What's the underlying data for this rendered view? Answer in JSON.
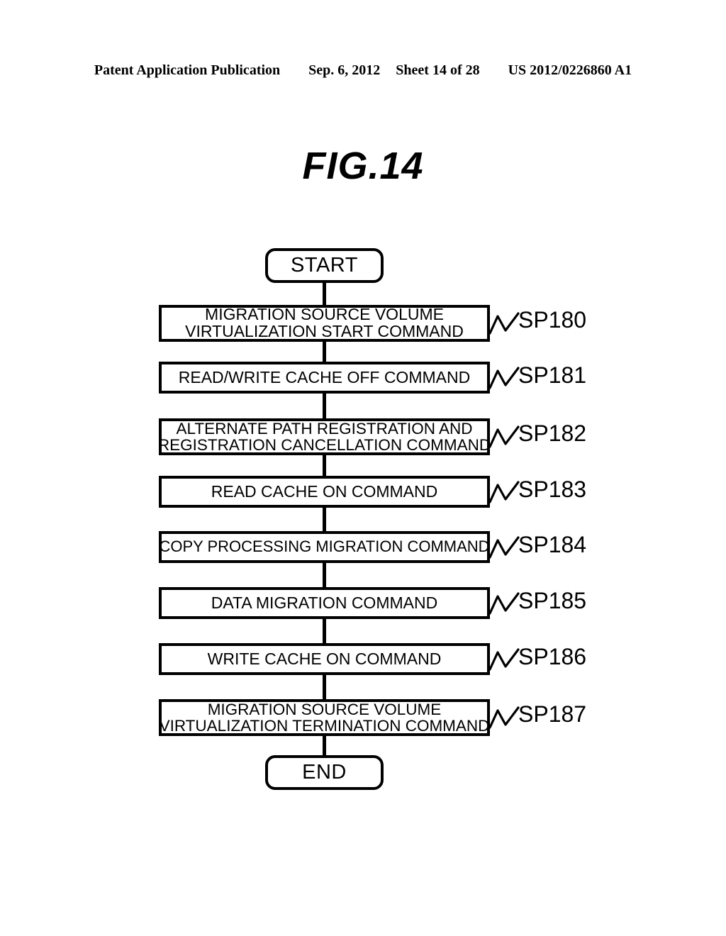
{
  "header": {
    "publication": "Patent Application Publication",
    "date": "Sep. 6, 2012",
    "sheet": "Sheet 14 of 28",
    "doc_number": "US 2012/0226860 A1"
  },
  "figure": {
    "title": "FIG.14"
  },
  "flowchart": {
    "start_label": "START",
    "end_label": "END",
    "steps": [
      {
        "id": "SP180",
        "lines": [
          "MIGRATION SOURCE VOLUME",
          "VIRTUALIZATION START COMMAND"
        ]
      },
      {
        "id": "SP181",
        "lines": [
          "READ/WRITE CACHE OFF COMMAND"
        ]
      },
      {
        "id": "SP182",
        "lines": [
          "ALTERNATE PATH REGISTRATION AND",
          "REGISTRATION CANCELLATION COMMAND"
        ]
      },
      {
        "id": "SP183",
        "lines": [
          "READ CACHE ON COMMAND"
        ]
      },
      {
        "id": "SP184",
        "lines": [
          "COPY PROCESSING MIGRATION COMMAND"
        ]
      },
      {
        "id": "SP185",
        "lines": [
          "DATA MIGRATION COMMAND"
        ]
      },
      {
        "id": "SP186",
        "lines": [
          "WRITE CACHE ON COMMAND"
        ]
      },
      {
        "id": "SP187",
        "lines": [
          "MIGRATION SOURCE VOLUME",
          "VIRTUALIZATION TERMINATION COMMAND"
        ]
      }
    ]
  },
  "colors": {
    "ink": "#000000",
    "paper": "#ffffff"
  }
}
